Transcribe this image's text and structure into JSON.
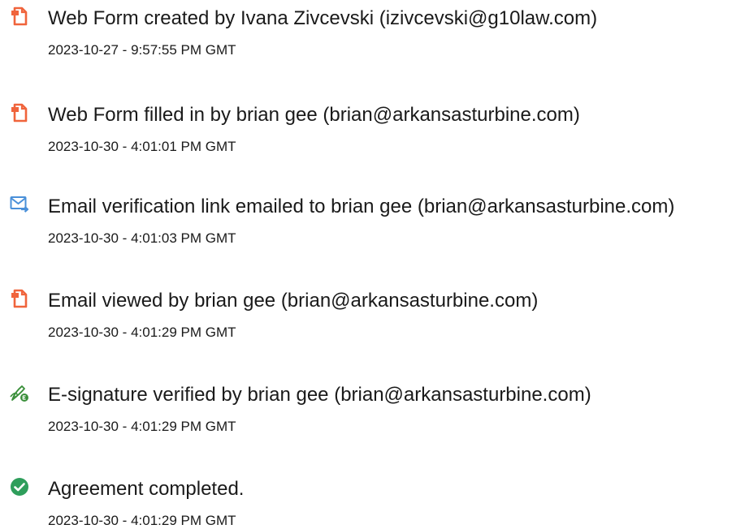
{
  "events": [
    {
      "icon": "document-icon",
      "title": "Web Form created by Ivana Zivcevski (izivcevski@g10law.com)",
      "timestamp": "2023-10-27 - 9:57:55 PM GMT"
    },
    {
      "icon": "document-icon",
      "title": "Web Form filled in by brian gee (brian@arkansasturbine.com)",
      "timestamp": "2023-10-30 - 4:01:01 PM GMT"
    },
    {
      "icon": "email-send-icon",
      "title": "Email verification link emailed to brian gee (brian@arkansasturbine.com)",
      "timestamp": "2023-10-30 - 4:01:03 PM GMT"
    },
    {
      "icon": "document-icon",
      "title": "Email viewed by brian gee (brian@arkansasturbine.com)",
      "timestamp": "2023-10-30 - 4:01:29 PM GMT"
    },
    {
      "icon": "signature-pen-icon",
      "title": "E-signature verified by brian gee (brian@arkansasturbine.com)",
      "timestamp": "2023-10-30 - 4:01:29 PM GMT"
    },
    {
      "icon": "check-circle-icon",
      "title": "Agreement completed.",
      "timestamp": "2023-10-30 - 4:01:29 PM GMT"
    }
  ],
  "colors": {
    "document_icon": "#f0643c",
    "email_icon": "#4a90d9",
    "signature_icon": "#3a8f3a",
    "check_icon": "#2e9e5b"
  }
}
